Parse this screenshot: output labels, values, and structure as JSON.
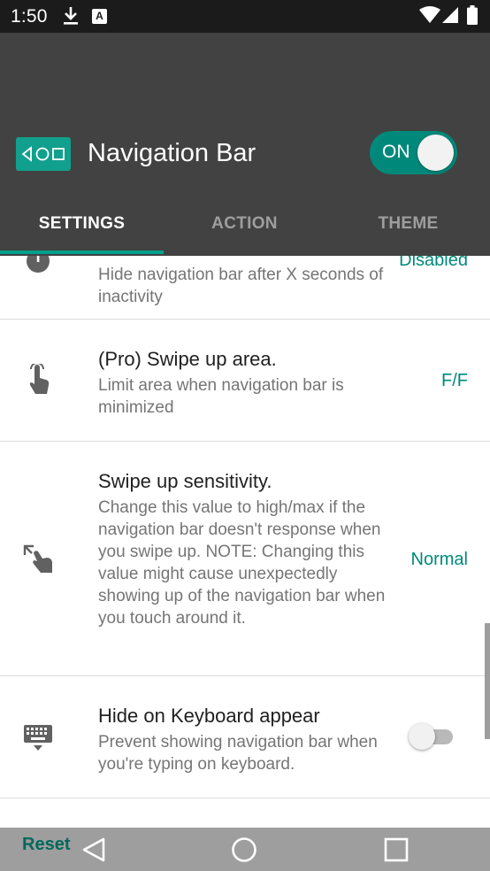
{
  "status_bar": {
    "time": "1:50",
    "icons": [
      "download-icon",
      "a-notification-icon",
      "wifi-icon",
      "signal-icon",
      "battery-icon"
    ]
  },
  "header": {
    "title": "Navigation Bar",
    "master_toggle": {
      "label": "ON",
      "state": true
    },
    "tabs": [
      {
        "label": "SETTINGS",
        "active": true
      },
      {
        "label": "ACTION",
        "active": false
      },
      {
        "label": "THEME",
        "active": false
      }
    ]
  },
  "settings": {
    "items": [
      {
        "icon": "timer-icon",
        "title": "",
        "summary": "Hide navigation bar after X seconds of inactivity",
        "value": "Disabled"
      },
      {
        "icon": "touch-icon",
        "title": "(Pro) Swipe up area.",
        "summary": "Limit area when navigation bar is minimized",
        "value": "F/F"
      },
      {
        "icon": "swipe-gesture-icon",
        "title": "Swipe up sensitivity.",
        "summary": "Change this value to high/max if the navigation bar doesn't response when you swipe up. NOTE: Changing this value might cause unexpectedly showing up of the navigation bar when you touch around it.",
        "value": "Normal"
      },
      {
        "icon": "keyboard-icon",
        "title": "Hide on Keyboard appear",
        "summary": "Prevent showing navigation bar when you're typing on keyboard.",
        "toggle": false
      }
    ]
  },
  "bottom_bar": {
    "reset_label": "Reset",
    "buttons": [
      "back-icon",
      "home-icon",
      "recents-icon"
    ]
  },
  "colors": {
    "accent": "#00897b",
    "header_bg": "#424242",
    "status_bg": "#1b1b1b",
    "navbar_bg": "#9e9e9e"
  }
}
